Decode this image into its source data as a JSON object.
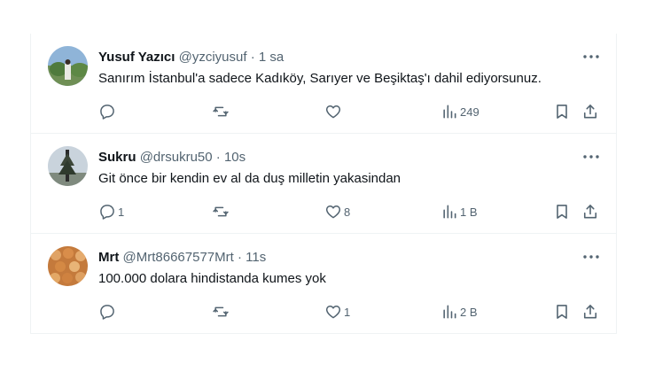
{
  "tweets": [
    {
      "name": "Yusuf Yazıcı",
      "handle": "@yzciyusuf",
      "separator": "·",
      "time": "1 sa",
      "text": "Sanırım İstanbul'a sadece Kadıköy, Sarıyer ve Beşiktaş'ı dahil ediyorsunuz.",
      "replies": "",
      "retweets": "",
      "likes": "",
      "views": "249"
    },
    {
      "name": "Sukru",
      "handle": "@drsukru50",
      "separator": "·",
      "time": "10s",
      "text": "Git önce bir kendin ev al da duş milletin yakasindan",
      "replies": "1",
      "retweets": "",
      "likes": "8",
      "views": "1 B"
    },
    {
      "name": "Mrt",
      "handle": "@Mrt86667577Mrt",
      "separator": "·",
      "time": "11s",
      "text": "100.000 dolara hindistanda kumes yok",
      "replies": "",
      "retweets": "",
      "likes": "1",
      "views": "2 B"
    }
  ],
  "icons": {
    "more": "more-dots-icon",
    "reply": "reply-icon",
    "retweet": "retweet-icon",
    "like": "heart-icon",
    "views": "views-chart-icon",
    "bookmark": "bookmark-icon",
    "share": "share-icon"
  },
  "colors": {
    "text": "#0f1419",
    "secondary": "#536471",
    "border": "#eff3f4"
  }
}
